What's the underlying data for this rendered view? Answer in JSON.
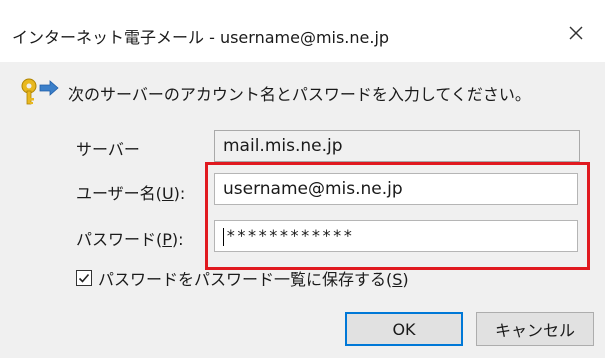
{
  "window": {
    "title": "インターネット電子メール - username@mis.ne.jp"
  },
  "prompt": "次のサーバーのアカウント名とパスワードを入力してください。",
  "fields": {
    "server_label": "サーバー",
    "server_value": "mail.mis.ne.jp",
    "username_label_prefix": "ユーザー名(",
    "username_label_key": "U",
    "username_label_suffix": "):",
    "username_value": "username@mis.ne.jp",
    "password_label_prefix": "パスワード(",
    "password_label_key": "P",
    "password_label_suffix": "):",
    "password_value": "************"
  },
  "checkbox": {
    "label_prefix": "パスワードをパスワード一覧に保存する(",
    "label_key": "S",
    "label_suffix": ")",
    "checked": true
  },
  "buttons": {
    "ok": "OK",
    "cancel": "キャンセル"
  },
  "colors": {
    "highlight": "#e0191f",
    "ok_border": "#0078d7"
  },
  "icons": {
    "close": "close-icon",
    "key": "key-icon",
    "check": "checkmark-icon"
  }
}
